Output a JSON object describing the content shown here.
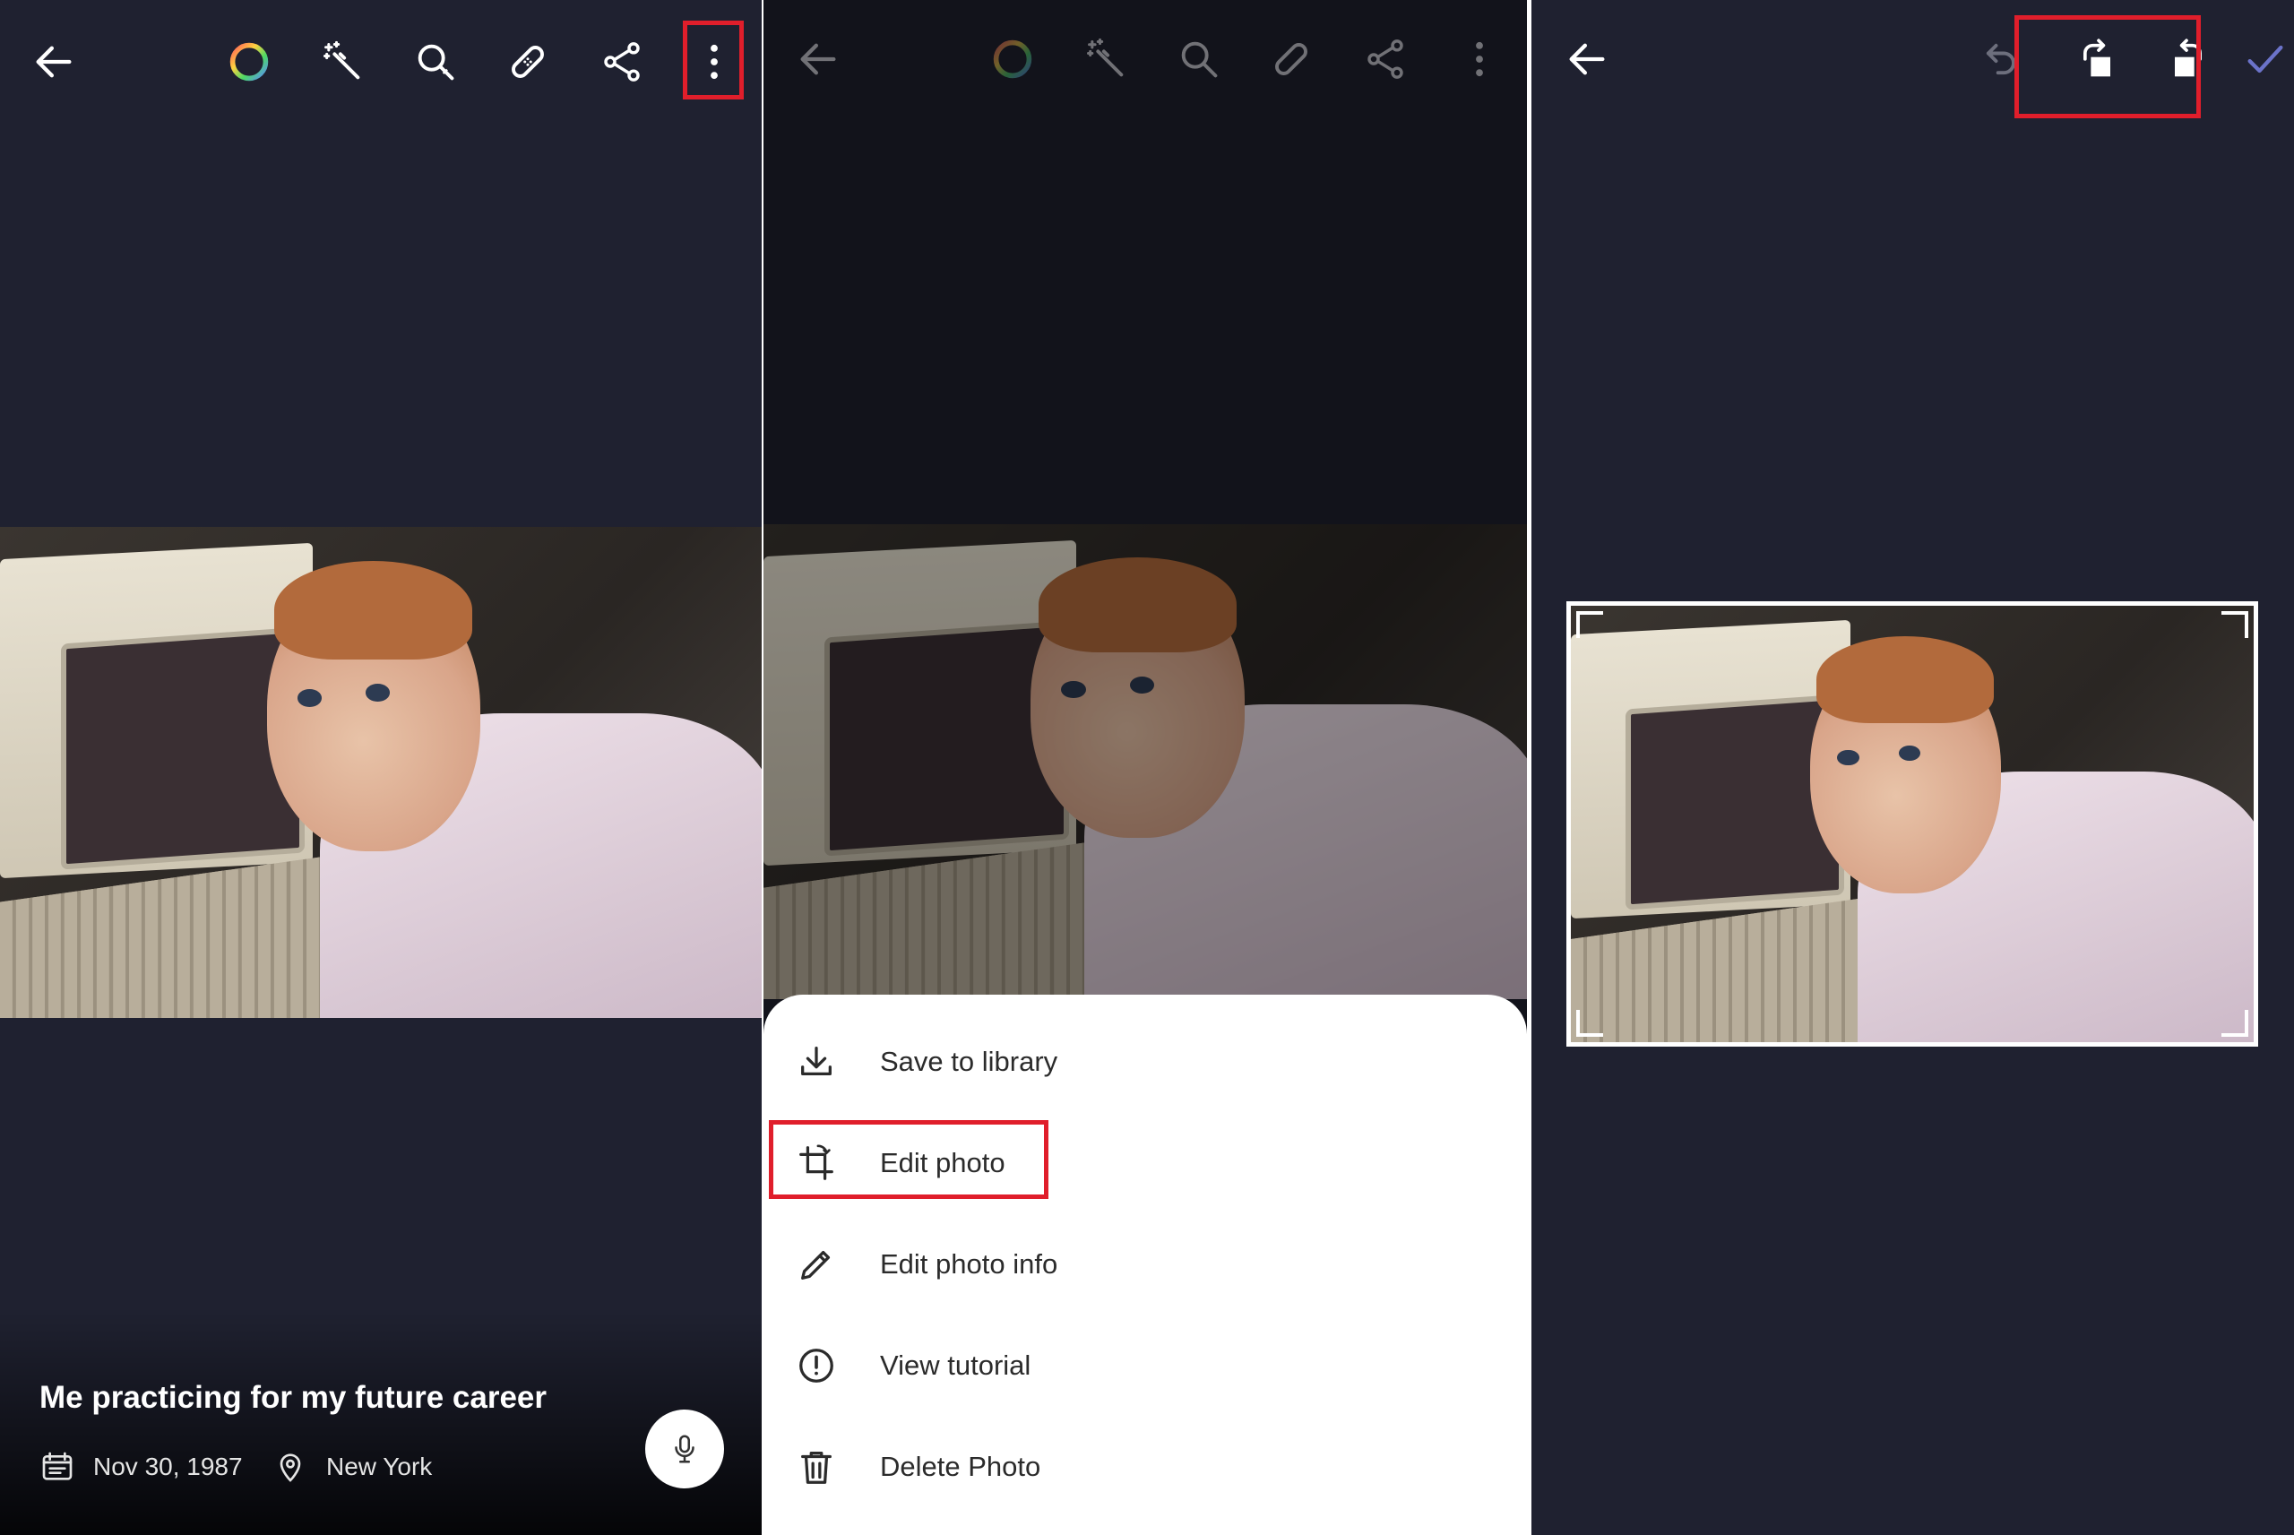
{
  "panel1": {
    "toolbar": {
      "back_icon": "arrow-left-icon",
      "tools": [
        "color-ring-icon",
        "magic-wand-icon",
        "magnify-enhance-icon",
        "bandage-repair-icon",
        "share-icon",
        "more-vert-icon"
      ]
    },
    "caption": "Me practicing for my future career",
    "date": "Nov 30, 1987",
    "location": "New York",
    "mic_icon": "microphone-icon",
    "highlight_color": "#e01e2b"
  },
  "panel2": {
    "menu": [
      {
        "label": "Save to library",
        "icon": "download-icon"
      },
      {
        "label": "Edit photo",
        "icon": "crop-rotate-icon"
      },
      {
        "label": "Edit photo info",
        "icon": "pencil-icon"
      },
      {
        "label": "View tutorial",
        "icon": "info-circle-icon"
      },
      {
        "label": "Delete Photo",
        "icon": "trash-icon"
      }
    ],
    "highlighted_item": "Edit photo"
  },
  "panel3": {
    "toolbar": {
      "back_icon": "arrow-left-icon",
      "undo_icon": "undo-icon",
      "rotate_right_icon": "rotate-right-icon",
      "rotate_left_icon": "rotate-left-icon",
      "confirm_icon": "check-icon"
    },
    "accent_color": "#6b73c9"
  },
  "colors": {
    "panel_bg": "#1f2130",
    "dim_bg": "#12131b",
    "sheet_bg": "#ffffff"
  }
}
